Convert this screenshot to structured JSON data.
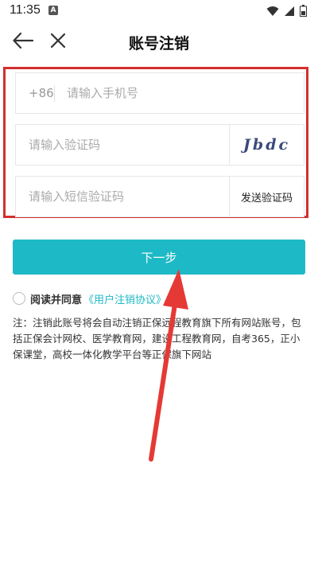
{
  "status_bar": {
    "time": "11:35",
    "notification_badge": "A"
  },
  "header": {
    "title": "账号注销"
  },
  "form": {
    "phone_prefix": "+86",
    "phone_placeholder": "请输入手机号",
    "captcha_placeholder": "请输入验证码",
    "captcha_image_text": "Jbdc",
    "sms_placeholder": "请输入短信验证码",
    "send_code_label": "发送验证码"
  },
  "next_button_label": "下一步",
  "agreement": {
    "text": "阅读并同意",
    "link_text": "《用户注销协议》"
  },
  "note": "注：注销此账号将会自动注销正保远程教育旗下所有网站账号，包括正保会计网校、医学教育网，建设工程教育网，自考365，正小保课堂，高校一体化教学平台等正保旗下网站",
  "colors": {
    "accent": "#1eb9c6",
    "annotation_red": "#e53935"
  }
}
